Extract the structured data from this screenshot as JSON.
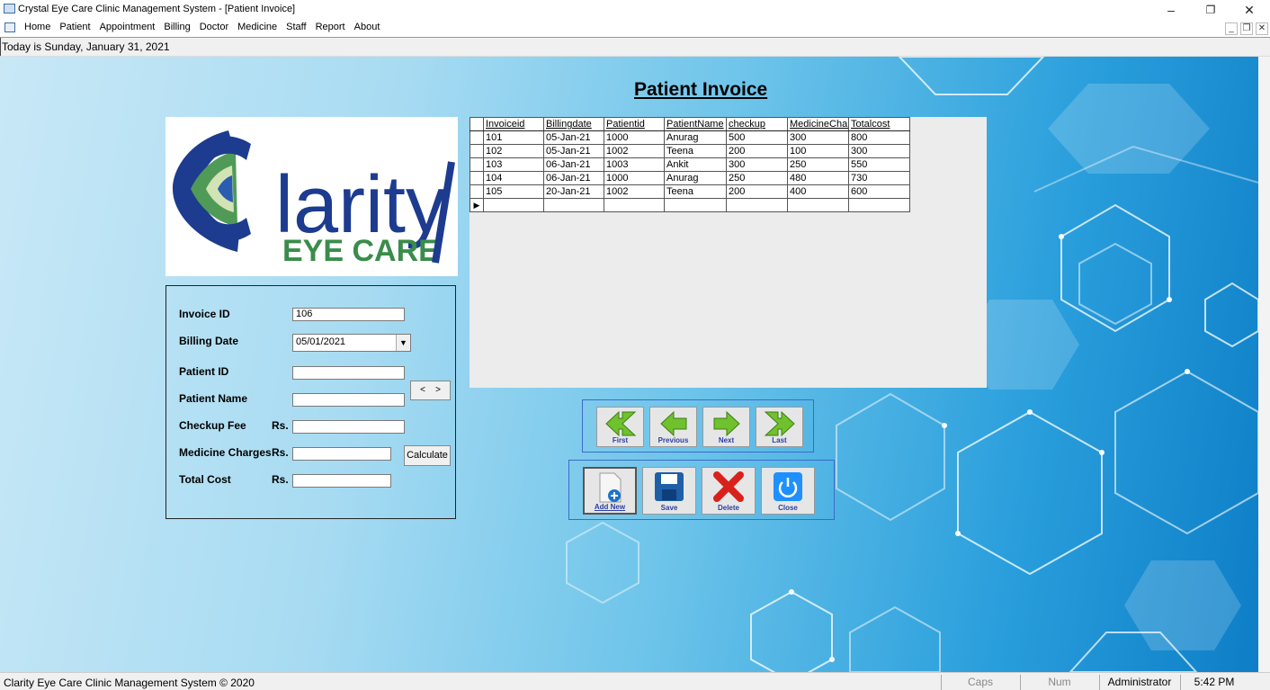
{
  "window": {
    "title": "Crystal Eye Care Clinic Management System - [Patient Invoice]",
    "minimize_glyph": "–",
    "restore_glyph": "❐",
    "close_glyph": "✕"
  },
  "menu": {
    "items": [
      "Home",
      "Patient",
      "Appointment",
      "Billing",
      "Doctor",
      "Medicine",
      "Staff",
      "Report",
      "About"
    ],
    "mdi_minimize": "_",
    "mdi_restore": "❐",
    "mdi_close": "✕"
  },
  "date_bar": {
    "text": "Today is Sunday, January 31, 2021"
  },
  "page": {
    "heading": "Patient Invoice"
  },
  "logo": {
    "brand": "Clarity",
    "sub": "EYE CARE",
    "logo_name": "clarity-eye-care-logo"
  },
  "form": {
    "invoice_id_label": "Invoice ID",
    "invoice_id_value": "106",
    "billing_date_label": "Billing Date",
    "billing_date_value": "05/01/2021",
    "patient_id_label": "Patient ID",
    "patient_id_value": "",
    "patient_name_label": "Patient Name",
    "patient_name_value": "",
    "checkup_fee_label": "Checkup Fee",
    "medicine_charges_label": "Medicine Charges",
    "total_cost_label": "Total Cost",
    "currency": "Rs.",
    "checkup_fee_value": "",
    "medicine_charges_value": "",
    "total_cost_value": "",
    "prev_glyph": "<",
    "next_glyph": ">",
    "calculate_label": "Calculate"
  },
  "grid": {
    "columns": [
      "Invoiceid",
      "Billingdate",
      "Patientid",
      "PatientName",
      "checkup",
      "MedicineCharg",
      "Totalcost"
    ],
    "rows": [
      [
        "101",
        "05-Jan-21",
        "1000",
        "Anurag",
        "500",
        "300",
        "800"
      ],
      [
        "102",
        "05-Jan-21",
        "1002",
        "Teena",
        "200",
        "100",
        "300"
      ],
      [
        "103",
        "06-Jan-21",
        "1003",
        "Ankit",
        "300",
        "250",
        "550"
      ],
      [
        "104",
        "06-Jan-21",
        "1000",
        "Anurag",
        "250",
        "480",
        "730"
      ],
      [
        "105",
        "20-Jan-21",
        "1002",
        "Teena",
        "200",
        "400",
        "600"
      ]
    ],
    "new_row_marker": "▶"
  },
  "nav_buttons": {
    "first": "First",
    "previous": "Previous",
    "next": "Next",
    "last": "Last"
  },
  "action_buttons": {
    "add_new": "Add New",
    "save": "Save",
    "delete": "Delete",
    "close": "Close"
  },
  "status": {
    "app": "Clarity Eye Care Clinic Management System © 2020",
    "caps": "Caps",
    "num": "Num",
    "user": "Administrator",
    "time": "5:42 PM"
  },
  "colors": {
    "accent_border": "#3b6bc8",
    "arrow_green": "#6fc12e",
    "delete_red": "#d9211c",
    "save_blue": "#1f5fa8",
    "close_blue": "#1e90ff"
  }
}
